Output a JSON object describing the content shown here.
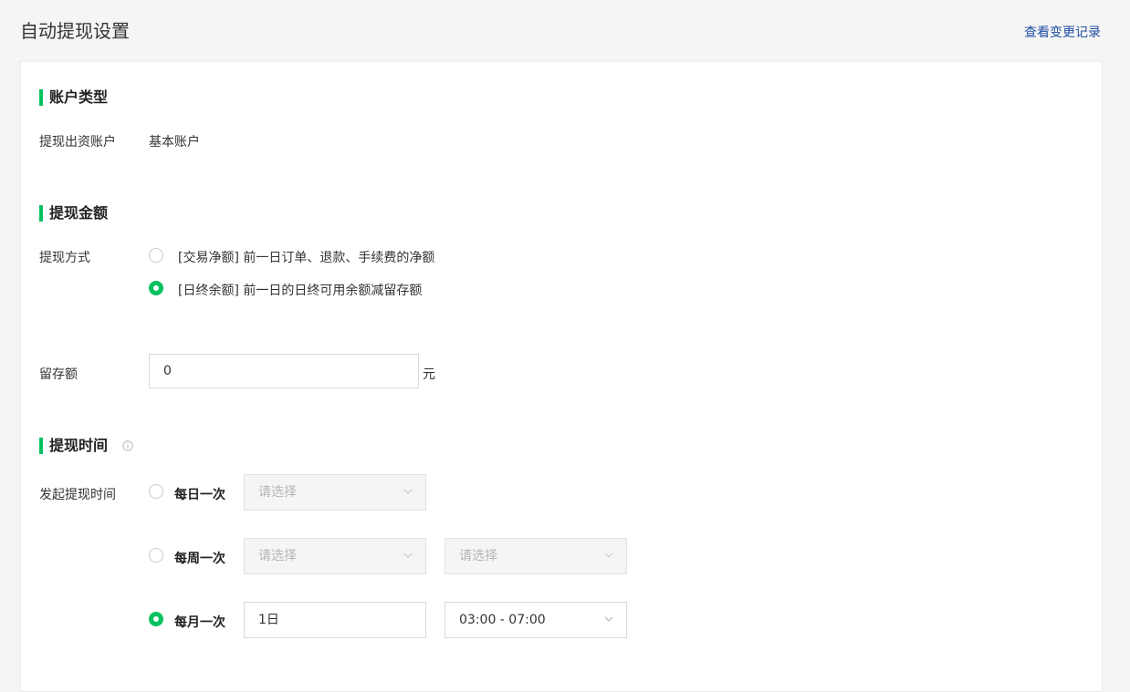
{
  "header": {
    "title": "自动提现设置",
    "history_link": "查看变更记录"
  },
  "account_section": {
    "title": "账户类型",
    "label": "提现出资账户",
    "value": "基本账户"
  },
  "amount_section": {
    "title": "提现金额",
    "method_label": "提现方式",
    "options": [
      {
        "label": "[交易净额] 前一日订单、退款、手续费的净额",
        "checked": false
      },
      {
        "label": "[日终余额] 前一日的日终可用余额减留存额",
        "checked": true
      }
    ],
    "reserve_label": "留存额",
    "reserve_value": "0",
    "reserve_unit": "元"
  },
  "time_section": {
    "title": "提现时间",
    "info_icon": "info-circle-icon",
    "start_label": "发起提现时间",
    "daily": {
      "label": "每日一次",
      "checked": false,
      "select_placeholder": "请选择"
    },
    "weekly": {
      "label": "每周一次",
      "checked": false,
      "day_placeholder": "请选择",
      "time_placeholder": "请选择"
    },
    "monthly": {
      "label": "每月一次",
      "checked": true,
      "day_value": "1日",
      "time_value": "03:00 - 07:00"
    }
  },
  "colors": {
    "accent": "#07c160",
    "link": "#1f4fa3"
  }
}
